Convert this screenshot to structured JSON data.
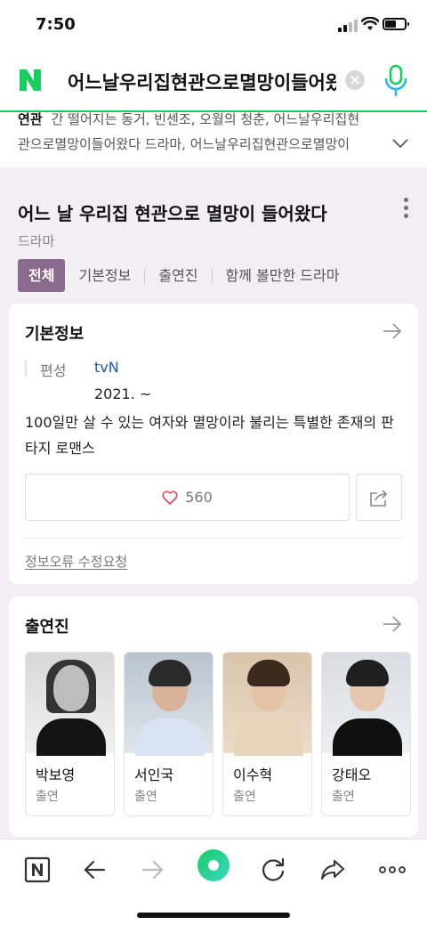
{
  "status_bar": {
    "time": "7:50"
  },
  "search": {
    "query": "어느날우리집현관으로멸망이들어왔다"
  },
  "related": {
    "label": "연관",
    "line1": "간 떨어지는 동거, 빈센조, 오월의 청춘, 어느날우리집현",
    "line2": "관으로멸망이들어왔다 드라마, 어느날우리집현관으로멸망이"
  },
  "header": {
    "title": "어느 날 우리집 현관으로 멸망이 들어왔다",
    "genre": "드라마",
    "tabs": [
      "전체",
      "기본정보",
      "출연진",
      "함께 볼만한 드라마"
    ]
  },
  "basic_info": {
    "title": "기본정보",
    "label": "편성",
    "channel": "tvN",
    "date": "2021. ~",
    "description": "100일만 살 수 있는 여자와 멸망이라 불리는 특별한 존재의 판타지 로맨스",
    "likes": "560",
    "report_link": "정보오류 수정요청"
  },
  "cast": {
    "title": "출연진",
    "members": [
      {
        "name": "박보영",
        "role": "출연"
      },
      {
        "name": "서인국",
        "role": "출연"
      },
      {
        "name": "이수혁",
        "role": "출연"
      },
      {
        "name": "강태오",
        "role": "출연"
      }
    ]
  },
  "colors": {
    "naver_green": "#19ce60",
    "tab_active": "#8a6a8d",
    "link_blue": "#1a55b5"
  },
  "icons": [
    "naver-logo-icon",
    "clear-icon",
    "mic-icon",
    "chevron-down-icon",
    "more-icon",
    "arrow-right-icon",
    "heart-icon",
    "share-icon",
    "back-icon",
    "forward-icon",
    "green-dot-icon",
    "reload-icon",
    "share-arrow-icon",
    "more-horizontal-icon"
  ]
}
